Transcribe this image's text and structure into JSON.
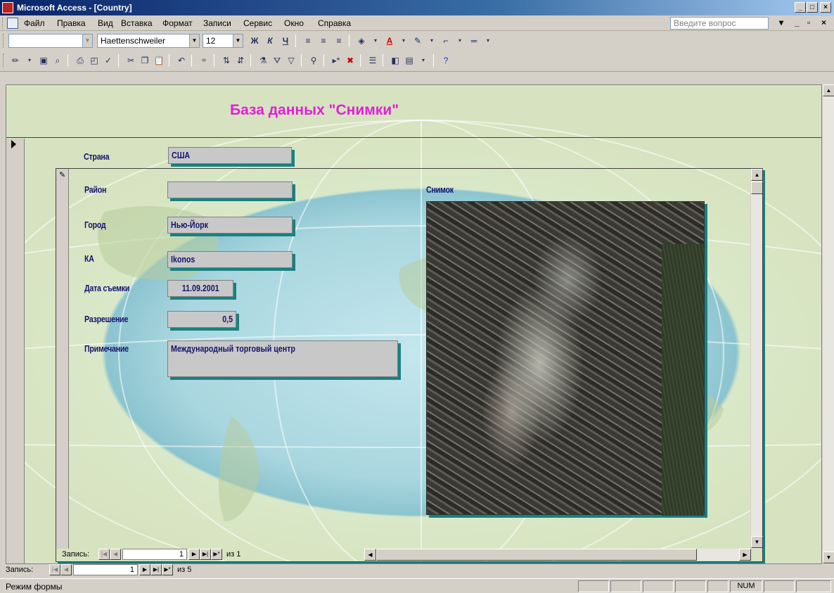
{
  "window": {
    "title": "Microsoft Access - [Country]",
    "minimize": "_",
    "maximize": "□",
    "close": "×"
  },
  "menu": {
    "items": [
      {
        "label": "Файл"
      },
      {
        "label": "Правка"
      },
      {
        "label": "Вид"
      },
      {
        "label": "Вставка"
      },
      {
        "label": "Формат"
      },
      {
        "label": "Записи"
      },
      {
        "label": "Сервис"
      },
      {
        "label": "Окно"
      },
      {
        "label": "Справка"
      }
    ],
    "help_placeholder": "Введите вопрос"
  },
  "format_toolbar": {
    "object_combo": "",
    "font_name": "Haettenschweiler",
    "font_size": "12",
    "bold": "Ж",
    "italic": "К",
    "underline": "Ч"
  },
  "form": {
    "title": "База данных \"Снимки\"",
    "country_label": "Страна",
    "country_value": "США",
    "district_label": "Район",
    "district_value": "",
    "city_label": "Город",
    "city_value": "Нью-Йорк",
    "satellite_label": "КА",
    "satellite_value": "Ikonos",
    "date_label": "Дата съемки",
    "date_value": "11.09.2001",
    "resolution_label": "Разрешение",
    "resolution_value": "0,5",
    "note_label": "Примечание",
    "note_value": "Международный торговый центр",
    "image_label": "Снимок"
  },
  "sub_nav": {
    "label": "Запись:",
    "current": "1",
    "of": "из 1"
  },
  "main_nav": {
    "label": "Запись:",
    "current": "1",
    "of": "из 5"
  },
  "status": {
    "mode": "Режим формы",
    "num": "NUM"
  },
  "colors": {
    "title_magenta": "#e020d8",
    "label_navy": "#14146e",
    "field_shadow": "#1a8080",
    "field_bg": "#c8c8c8"
  }
}
